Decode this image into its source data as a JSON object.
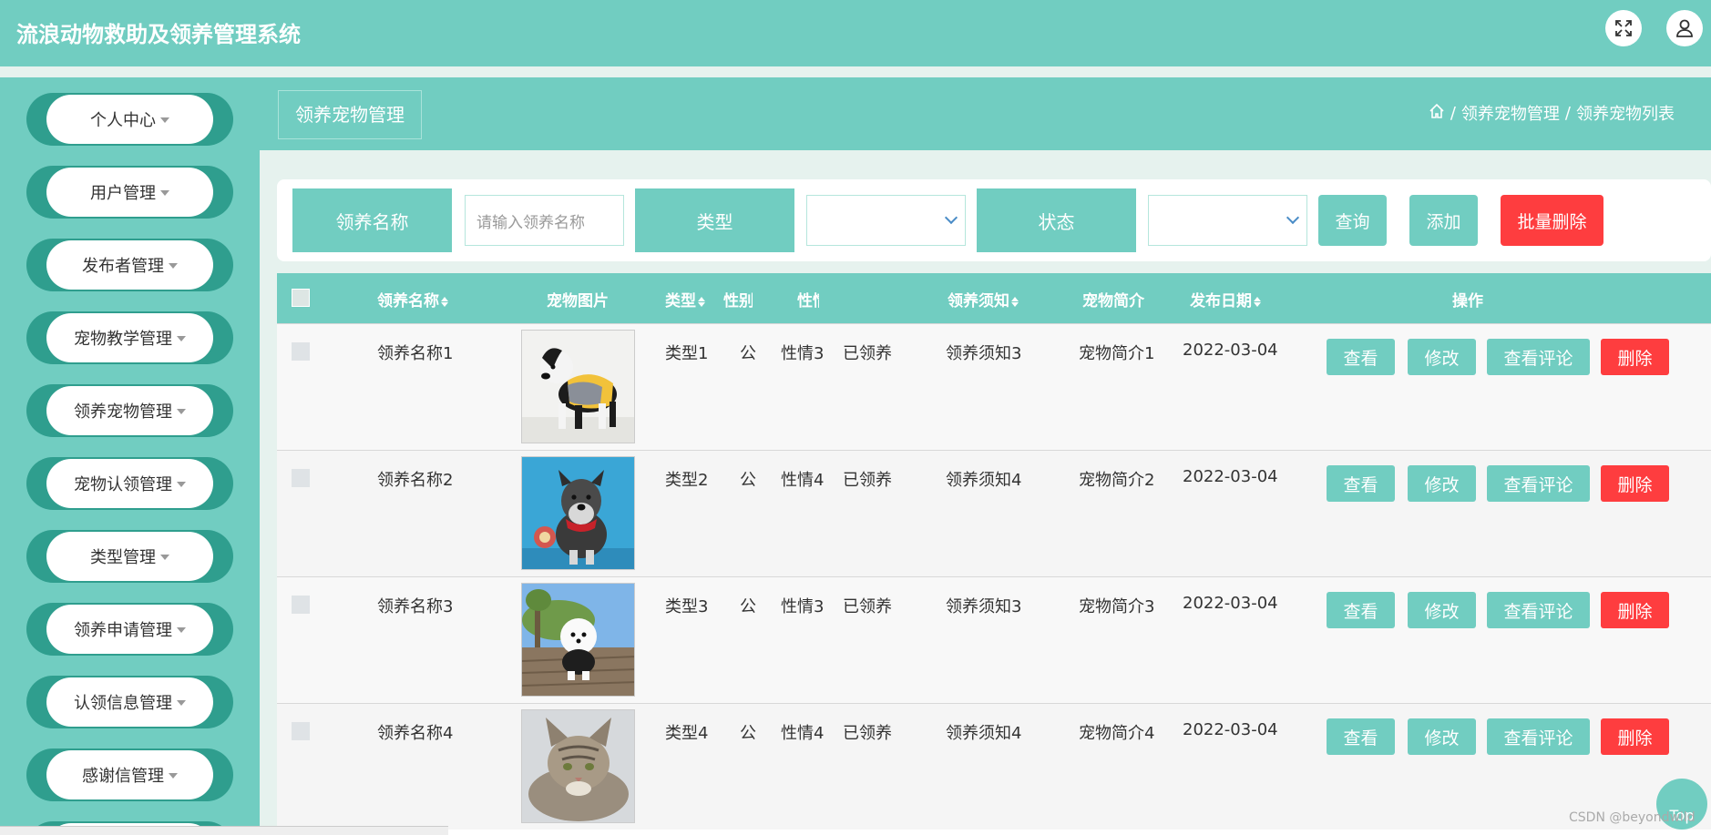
{
  "app": {
    "title": "流浪动物救助及领养管理系统"
  },
  "header": {
    "icons": [
      "fullscreen-icon",
      "user-icon"
    ]
  },
  "sidebar": {
    "items": [
      {
        "label": "个人中心"
      },
      {
        "label": "用户管理"
      },
      {
        "label": "发布者管理"
      },
      {
        "label": "宠物教学管理"
      },
      {
        "label": "领养宠物管理"
      },
      {
        "label": "宠物认领管理"
      },
      {
        "label": "类型管理"
      },
      {
        "label": "领养申请管理"
      },
      {
        "label": "认领信息管理"
      },
      {
        "label": "感谢信管理"
      }
    ]
  },
  "page": {
    "title": "领养宠物管理",
    "breadcrumb": {
      "home_icon": "home-icon",
      "sep": "/",
      "level1": "领养宠物管理",
      "level2": "领养宠物列表"
    }
  },
  "search": {
    "name_label": "领养名称",
    "name_placeholder": "请输入领养名称",
    "type_label": "类型",
    "status_label": "状态",
    "query_button": "查询",
    "add_button": "添加",
    "batch_delete_button": "批量删除"
  },
  "table": {
    "headers": {
      "name": "领养名称",
      "image": "宠物图片",
      "type": "类型",
      "gender": "性别",
      "temper": "性情",
      "notice": "领养须知",
      "intro": "宠物简介",
      "date": "发布日期",
      "actions": "操作"
    },
    "rows": [
      {
        "name": "领养名称1",
        "type": "类型1",
        "gender": "公",
        "temper": "性情3",
        "status": "已领养",
        "notice": "领养须知3",
        "intro": "宠物简介1",
        "date": "2022-03-04"
      },
      {
        "name": "领养名称2",
        "type": "类型2",
        "gender": "公",
        "temper": "性情4",
        "status": "已领养",
        "notice": "领养须知4",
        "intro": "宠物简介2",
        "date": "2022-03-04"
      },
      {
        "name": "领养名称3",
        "type": "类型3",
        "gender": "公",
        "temper": "性情3",
        "status": "已领养",
        "notice": "领养须知3",
        "intro": "宠物简介3",
        "date": "2022-03-04"
      },
      {
        "name": "领养名称4",
        "type": "类型4",
        "gender": "公",
        "temper": "性情4",
        "status": "已领养",
        "notice": "领养须知4",
        "intro": "宠物简介4",
        "date": "2022-03-04"
      }
    ],
    "actions": {
      "view": "查看",
      "edit": "修改",
      "comments": "查看评论",
      "delete": "删除"
    }
  },
  "footer": {
    "top_button": "Top",
    "watermark": "CSDN @beyondwild"
  },
  "colors": {
    "primary": "#71cdc1",
    "primary_dark": "#2f9e8e",
    "danger": "#fe3d3f"
  }
}
